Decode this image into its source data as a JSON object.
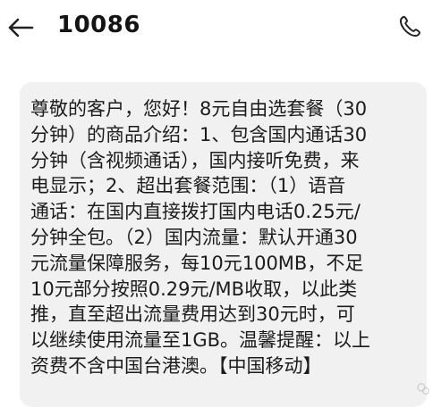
{
  "header": {
    "title": "10086",
    "back_icon": "arrow-left-icon",
    "call_icon": "phone-icon"
  },
  "message": {
    "lines": [
      "尊敬的客户，您好！8元自由选套餐（30",
      "分钟）的商品介绍：1、包含国内通话30",
      "分钟（含视频通话），国内接听免费，来",
      "电显示；2、超出套餐范围：（1）语音",
      "通话：在国内直接拨打国内电话0.25元/",
      "分钟全包。（2）国内流量：默认开通30",
      "元流量保障服务，每10元100MB，不足",
      "10元部分按照0.29元/MB收取，以此类",
      "推，直至超出流量费用达到30元时，可",
      "以继续使用流量至1GB。温馨提醒：以上",
      "资费不含中国台港澳。【中国移动】"
    ]
  },
  "colors": {
    "background": "#ffffff",
    "bubble": "#f1f1f1",
    "text": "#1c1c1c"
  }
}
